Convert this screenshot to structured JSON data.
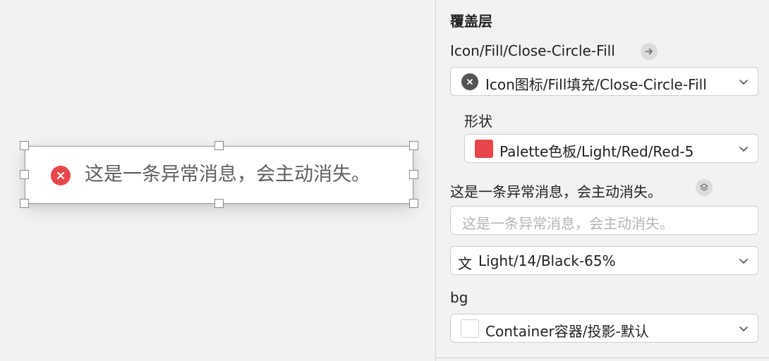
{
  "canvas": {
    "toast": {
      "message": "这是一条异常消息，会主动消失。",
      "icon": "close-circle-fill-icon",
      "icon_color": "#e8464a"
    }
  },
  "inspector": {
    "section_title": "覆盖层",
    "icon_override": {
      "symbol_label": "Icon/Fill/Close-Circle-Fill",
      "selected": "Icon图标/Fill填充/Close-Circle-Fill"
    },
    "shape": {
      "label": "形状",
      "selected": "Palette色板/Light/Red/Red-5",
      "swatch_color": "#e8464a"
    },
    "text_override": {
      "label": "这是一条异常消息，会主动消失。",
      "placeholder": "这是一条异常消息，会主动消失。",
      "text_style_glyph": "文",
      "text_style": "Light/14/Black-65%"
    },
    "bg": {
      "label": "bg",
      "selected": "Container容器/投影-默认"
    }
  }
}
